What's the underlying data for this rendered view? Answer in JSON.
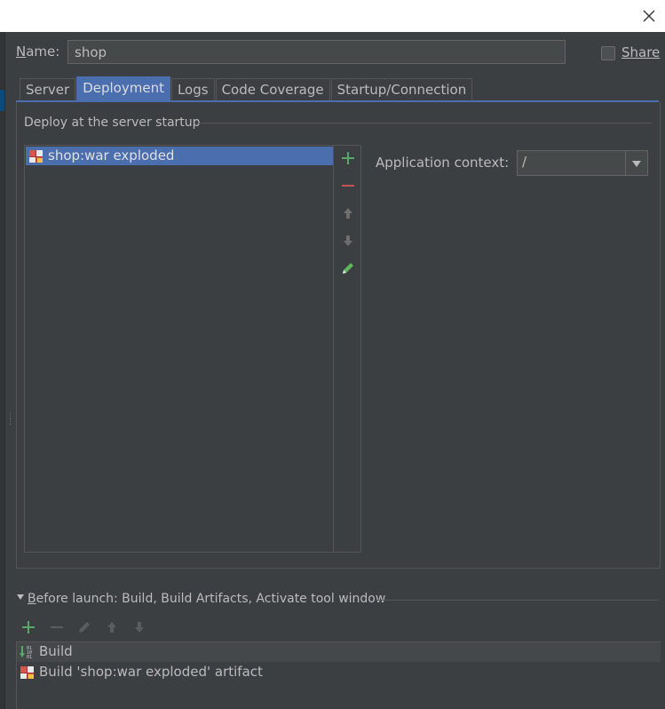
{
  "dialog": {
    "close_icon": "close-icon"
  },
  "config": {
    "name_label_mnemonic": "N",
    "name_label_rest": "ame:",
    "name_value": "shop",
    "share_label": "Share",
    "share_checked": false
  },
  "tabs": [
    {
      "label": "Server",
      "active": false
    },
    {
      "label": "Deployment",
      "active": true
    },
    {
      "label": "Logs",
      "active": false
    },
    {
      "label": "Code Coverage",
      "active": false
    },
    {
      "label": "Startup/Connection",
      "active": false
    }
  ],
  "deployment": {
    "section_title": "Deploy at the server startup",
    "artifacts": [
      {
        "label": "shop:war exploded",
        "icon": "artifact-icon",
        "selected": true
      }
    ],
    "toolbar": {
      "add_icon": "plus-icon",
      "remove_icon": "minus-icon",
      "move_up_icon": "arrow-up-icon",
      "move_down_icon": "arrow-down-icon",
      "edit_icon": "pencil-icon"
    },
    "context_label": "Application context:",
    "context_value": "/"
  },
  "before_launch": {
    "title_mnemonic": "B",
    "title_rest": "efore launch: Build, Build Artifacts, Activate tool window",
    "items": [
      {
        "label": "Build",
        "icon": "build-icon"
      },
      {
        "label": "Build 'shop:war exploded' artifact",
        "icon": "artifact-icon"
      }
    ]
  },
  "colors": {
    "background": "#3c3f41",
    "selection": "#4b6eaf",
    "text": "#bbbbbb",
    "add_green": "#59a869",
    "remove_red": "#c75450"
  }
}
